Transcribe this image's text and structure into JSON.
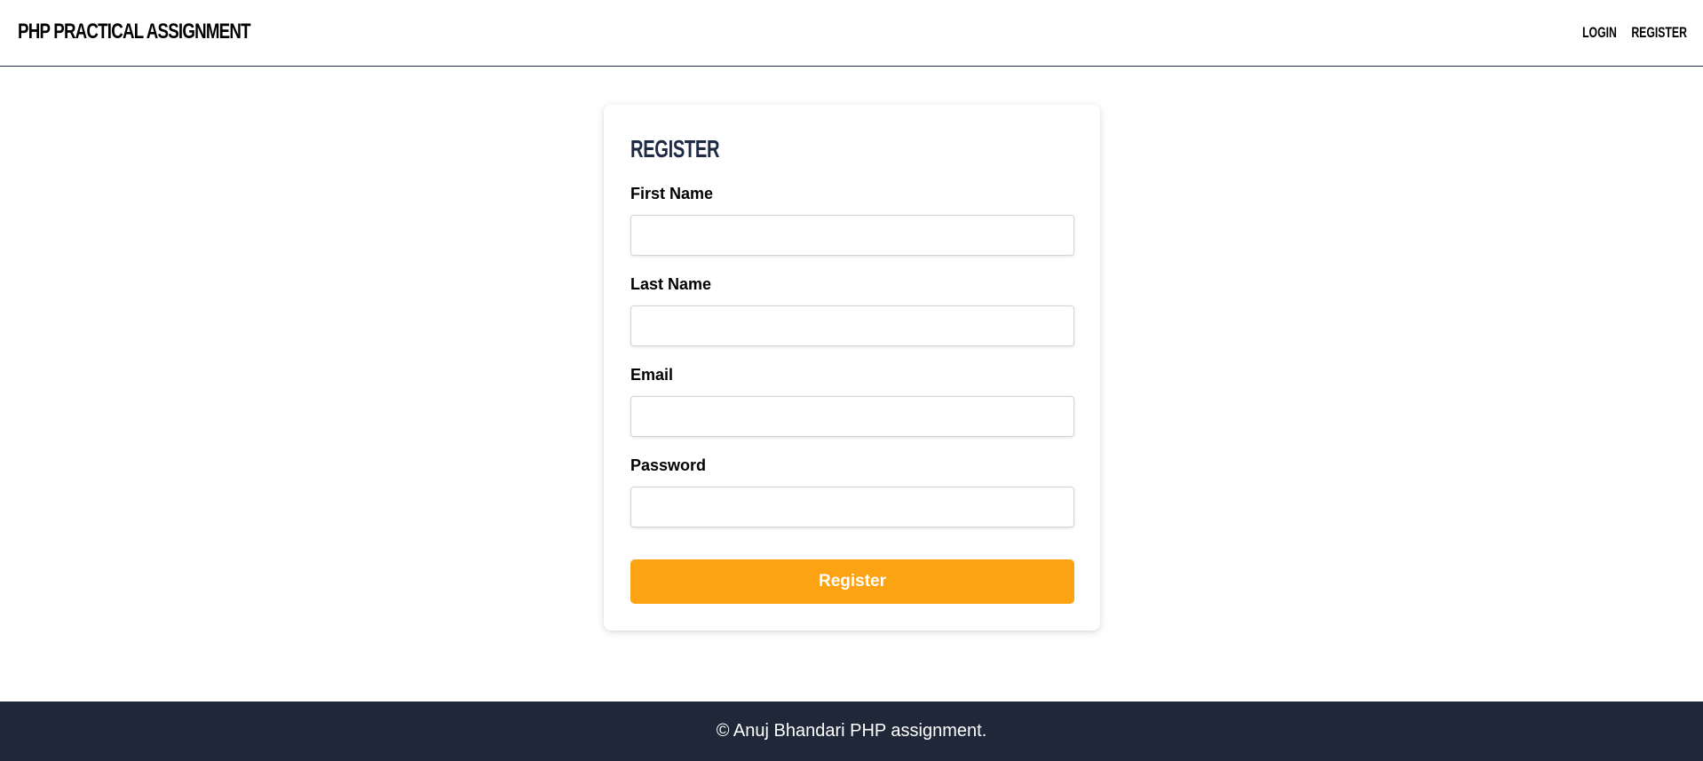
{
  "navbar": {
    "brand": "PHP PRACTICAL ASSIGNMENT",
    "links": [
      {
        "label": "LOGIN"
      },
      {
        "label": "REGISTER"
      }
    ]
  },
  "form": {
    "title": "REGISTER",
    "fields": [
      {
        "label": "First Name",
        "value": "",
        "placeholder": ""
      },
      {
        "label": "Last Name",
        "value": "",
        "placeholder": ""
      },
      {
        "label": "Email",
        "value": "",
        "placeholder": ""
      },
      {
        "label": "Password",
        "value": "",
        "placeholder": ""
      }
    ],
    "submit_label": "Register"
  },
  "footer": {
    "text": "© Anuj Bhandari PHP assignment."
  },
  "colors": {
    "accent": "#fba313",
    "title": "#1f2a44",
    "footer_bg": "#1f2839"
  }
}
